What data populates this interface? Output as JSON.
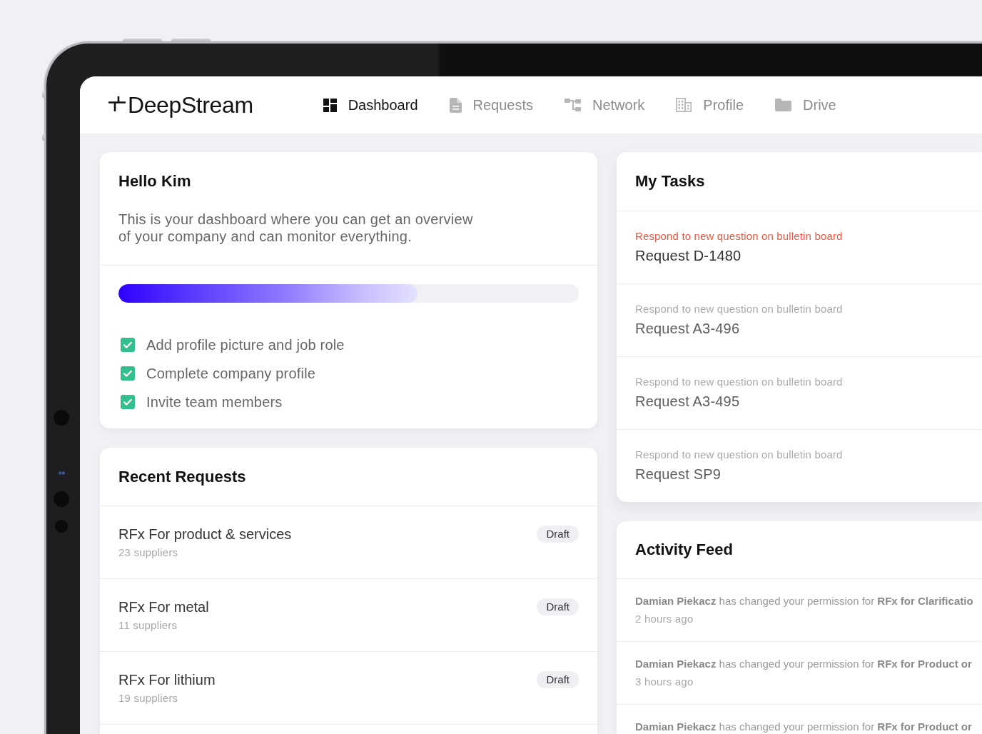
{
  "header": {
    "brand": "DeepStream",
    "nav": [
      {
        "label": "Dashboard",
        "selected": true
      },
      {
        "label": "Requests",
        "selected": false
      },
      {
        "label": "Network",
        "selected": false
      },
      {
        "label": "Profile",
        "selected": false
      },
      {
        "label": "Drive",
        "selected": false
      }
    ]
  },
  "welcome": {
    "title": "Hello Kim",
    "text": "This is your dashboard where you can get an overview of your company and can monitor everything.",
    "progress": {
      "level": 0.65
    },
    "checklist": [
      {
        "label": "Add profile picture and job role",
        "checked": true
      },
      {
        "label": "Complete company profile",
        "checked": true
      },
      {
        "label": "Invite team members",
        "checked": true
      }
    ]
  },
  "recent_requests": {
    "title": "Recent Requests",
    "rows": [
      {
        "name": "RFx For product & services",
        "suppliers": "23 suppliers",
        "status": "Draft"
      },
      {
        "name": "RFx For metal",
        "suppliers": "11 suppliers",
        "status": "Draft"
      },
      {
        "name": "RFx For lithium",
        "suppliers": "19 suppliers",
        "status": "Draft"
      }
    ]
  },
  "my_tasks": {
    "title": "My Tasks",
    "items": [
      {
        "note": "Respond to new question on bulletin board",
        "request": "Request D-1480",
        "highlighted": true
      },
      {
        "note": "Respond to new question on bulletin board",
        "request": "Request A3-496",
        "highlighted": false
      },
      {
        "note": "Respond to new question on bulletin board",
        "request": "Request A3-495",
        "highlighted": false
      },
      {
        "note": "Respond to new question on bulletin board",
        "request": "Request SP9",
        "highlighted": false
      }
    ]
  },
  "activity_feed": {
    "title": "Activity Feed",
    "items": [
      {
        "text": "**Damian Piekacz** has changed your permission for **RFx for Clarificatio**",
        "time": "2 hours ago"
      },
      {
        "text": "**Damian Piekacz** has changed your permission for **RFx for Product or**",
        "time": "3 hours ago"
      },
      {
        "text": "**Damian Piekacz** has changed your permission for **RFx for Product or**"
      }
    ]
  }
}
